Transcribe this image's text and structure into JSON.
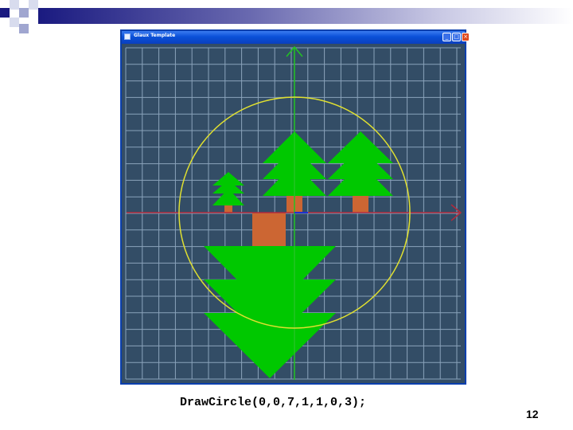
{
  "slide": {
    "caption": "DrawCircle(0,0,7,1,1,0,3);",
    "page_number": "12"
  },
  "window": {
    "title": "Glaux Template",
    "icon": "app-window-icon",
    "buttons": {
      "minimize_icon": "minimize-icon",
      "maximize_icon": "maximize-icon",
      "close_icon": "close-icon"
    }
  },
  "colors": {
    "slide_bar": "#1a1a80",
    "canvas_background": "#334d66",
    "grid": "#a8c0d8",
    "x_axis": "#b22a3c",
    "y_axis": "#22c422",
    "circle": "#e0e030",
    "tree_foliage": "#00c800",
    "tree_trunk": "#cc6633",
    "origin_mark": "#2030d0"
  }
}
